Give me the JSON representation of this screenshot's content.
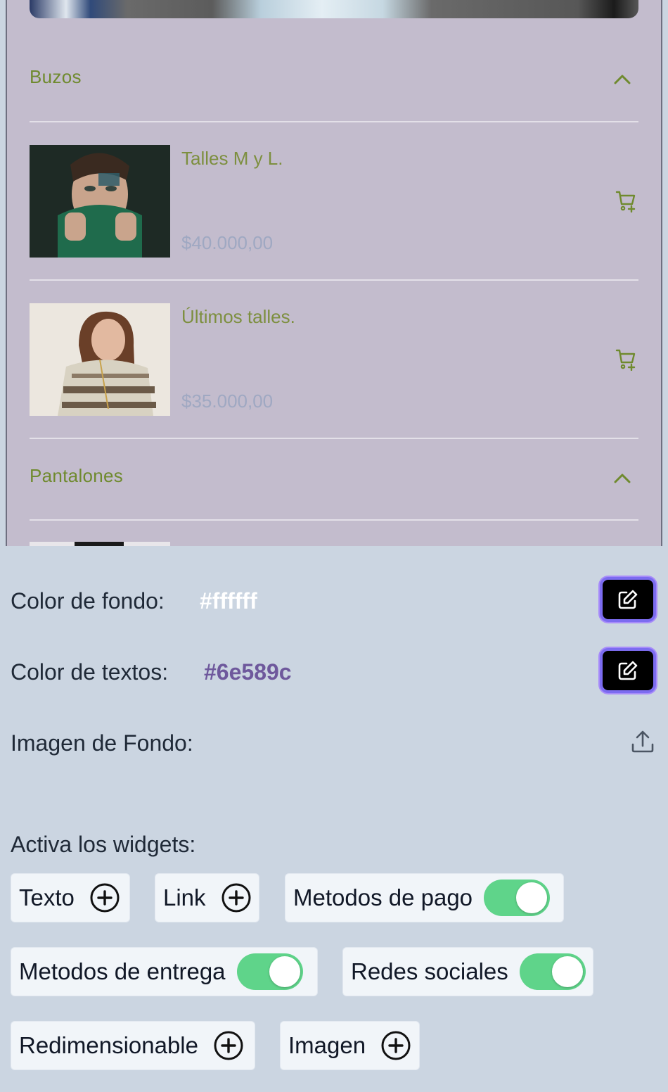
{
  "preview": {
    "sections": [
      {
        "title": "Buzos",
        "products": [
          {
            "title": "Talles M y L.",
            "price": "$40.000,00"
          },
          {
            "title": "Últimos talles.",
            "price": "$35.000,00"
          }
        ]
      },
      {
        "title": "Pantalones"
      }
    ],
    "colors": {
      "section_title": "#6f8a2e",
      "price": "#9fa8c2",
      "background": "#c3bccd"
    }
  },
  "settings": {
    "bg_color_label": "Color de fondo:",
    "bg_color_value": "#ffffff",
    "text_color_label": "Color de textos:",
    "text_color_value": "#6e589c",
    "bg_image_label": "Imagen de Fondo:",
    "widgets_label": "Activa los widgets:",
    "widgets": [
      {
        "label": "Texto",
        "control": "add",
        "icon": "plus-circle-icon"
      },
      {
        "label": "Link",
        "control": "add",
        "icon": "plus-circle-icon"
      },
      {
        "label": "Metodos de pago",
        "control": "toggle",
        "enabled": true
      },
      {
        "label": "Metodos de entrega",
        "control": "toggle",
        "enabled": true
      },
      {
        "label": "Redes sociales",
        "control": "toggle",
        "enabled": true
      },
      {
        "label": "Redimensionable",
        "control": "add",
        "icon": "plus-circle-icon"
      },
      {
        "label": "Imagen",
        "control": "add",
        "icon": "plus-circle-icon"
      }
    ],
    "icons": {
      "edit": "edit-icon",
      "upload": "upload-icon",
      "cart": "cart-plus-icon",
      "chevron": "chevron-up-icon"
    },
    "colors": {
      "toggle_on": "#5fd48a",
      "edit_button_border": "#7c6cf0",
      "panel_bg": "#cbd5e1"
    }
  }
}
